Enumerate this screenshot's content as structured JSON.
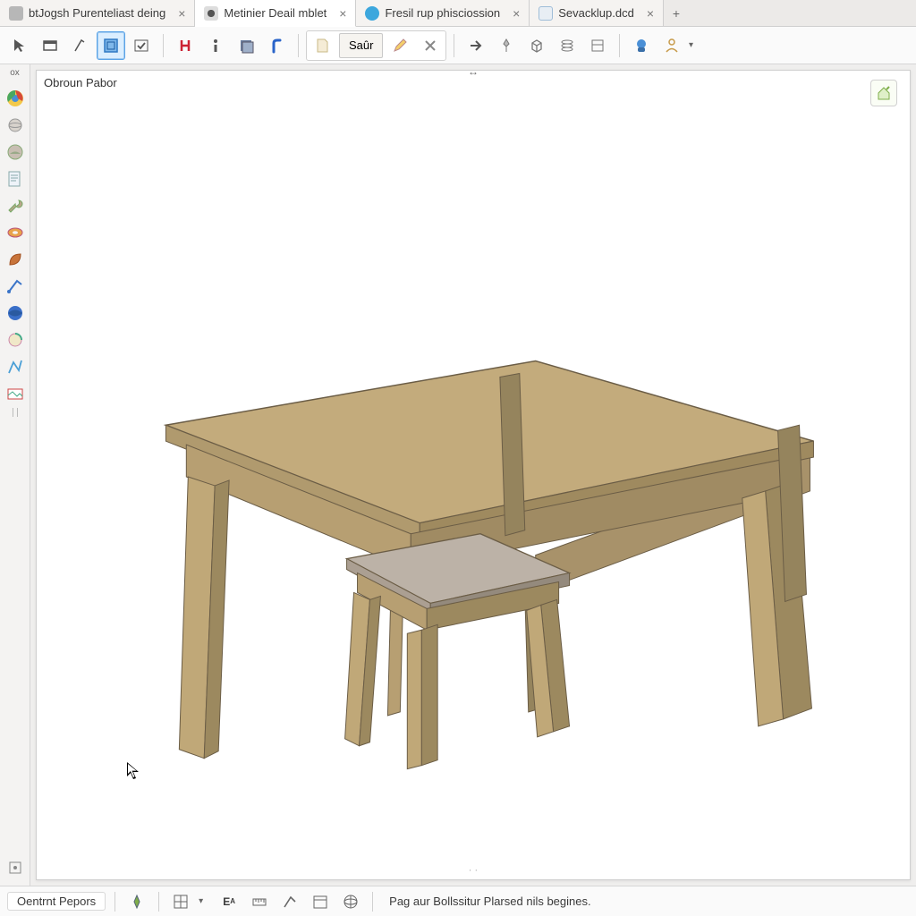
{
  "tabs": [
    {
      "label": "btJogsh Purenteliast deing",
      "icon_color": "#b7b7b7",
      "active": false
    },
    {
      "label": "Metinier Deail mblet",
      "icon_color": "#6b6b6b",
      "active": true
    },
    {
      "label": "Fresil rup phisciossion",
      "icon_color": "#3da7dd",
      "active": false
    },
    {
      "label": "Sevacklup.dcd",
      "icon_color": "#8fb7d9",
      "active": false
    }
  ],
  "toolbar": {
    "save_label": "Saûr",
    "icons": {
      "i0": "cursor-icon",
      "i1": "window-icon",
      "i2": "pen-angle-icon",
      "i3": "select-box-icon",
      "i4": "checklist-icon",
      "i5": "constraint-icon",
      "i6": "info-icon",
      "i7": "layers-icon",
      "i8": "extrude-icon",
      "i9": "sheet-icon",
      "i10": "pencil-icon",
      "i11": "delete-icon",
      "i12": "arrow-right-icon",
      "i13": "pin-icon",
      "i14": "cube-icon",
      "i15": "layers2-icon",
      "i16": "panel-icon",
      "i17": "robot-icon",
      "i18": "person-icon"
    }
  },
  "leftbar": {
    "header": "ox",
    "items": [
      "chrome-icon",
      "sphere-icon",
      "environment-icon",
      "notes-icon",
      "wrench-icon",
      "torus-icon",
      "leaf-icon",
      "sweep-icon",
      "globe-icon",
      "loop-icon",
      "path-icon",
      "screenshot-icon"
    ]
  },
  "viewport": {
    "doc_label": "Obroun Pabor",
    "center_handle": "↔",
    "view_widget_icon": "home-view-icon",
    "model_desc": "wooden table and small stool 3D model",
    "colors": {
      "table_top": "#c3ab7c",
      "table_top_edge": "#9f8a5f",
      "table_side": "#b49b6e",
      "stool_top": "#bcb2a7",
      "stool_side": "#a29787",
      "outline": "#5a5146"
    }
  },
  "statusbar": {
    "button_label": "Oentrnt Pepors",
    "message": "Pag aur Bollssitur Plarsed nils begines.",
    "icons": [
      "compass-icon",
      "grid-icon",
      "text-scale-icon",
      "measure-icon",
      "sketch-icon",
      "calendar-icon",
      "world-icon"
    ],
    "bottom_left_icon": "snap-icon"
  }
}
